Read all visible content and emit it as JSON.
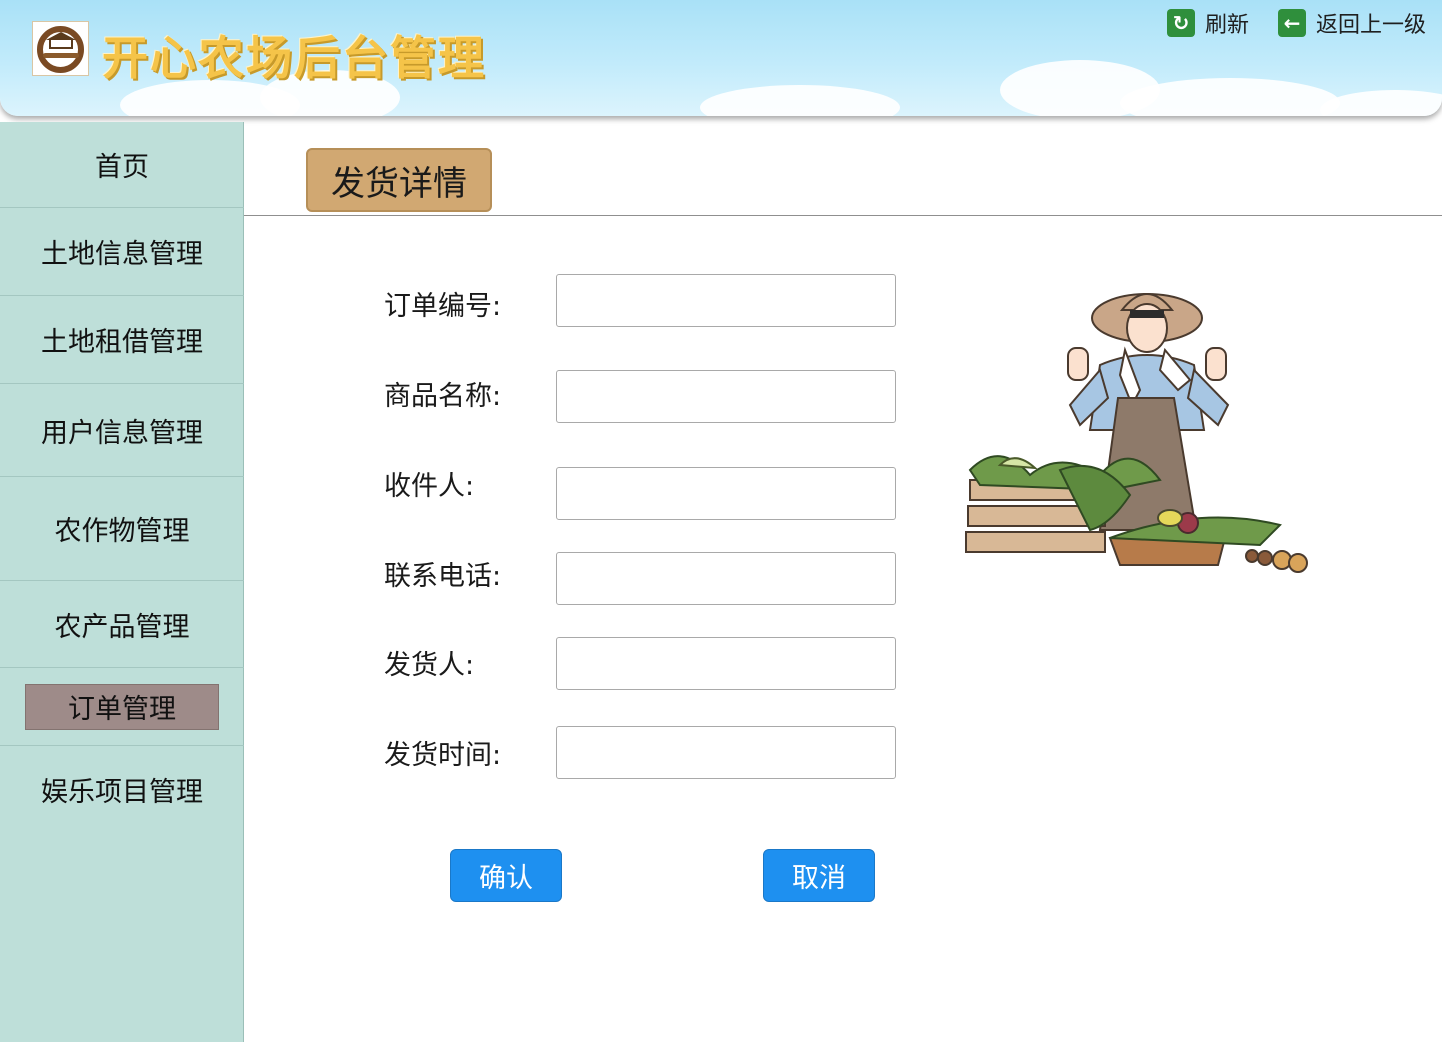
{
  "header": {
    "app_title": "开心农场后台管理",
    "refresh_label": "刷新",
    "back_label": "返回上一级",
    "refresh_icon": "refresh-icon",
    "back_icon": "back-arrow-icon"
  },
  "sidebar": {
    "items": [
      {
        "label": "首页"
      },
      {
        "label": "土地信息管理"
      },
      {
        "label": "土地租借管理"
      },
      {
        "label": "用户信息管理"
      },
      {
        "label": "农作物管理"
      },
      {
        "label": "农产品管理"
      },
      {
        "label": "订单管理",
        "active": true
      },
      {
        "label": "娱乐项目管理"
      }
    ]
  },
  "main": {
    "page_title": "发货详情",
    "fields": [
      {
        "label": "订单编号:",
        "value": ""
      },
      {
        "label": "商品名称:",
        "value": ""
      },
      {
        "label": "收件人:",
        "value": ""
      },
      {
        "label": "联系电话:",
        "value": ""
      },
      {
        "label": "发货人:",
        "value": ""
      },
      {
        "label": "发货时间:",
        "value": ""
      }
    ],
    "confirm_label": "确认",
    "cancel_label": "取消"
  },
  "colors": {
    "sidebar_bg": "#bedfd9",
    "active_item_bg": "#9e8b89",
    "title_badge_bg": "#d1a872",
    "button_blue": "#1e90f0",
    "header_sky": "#a9e1f7"
  }
}
